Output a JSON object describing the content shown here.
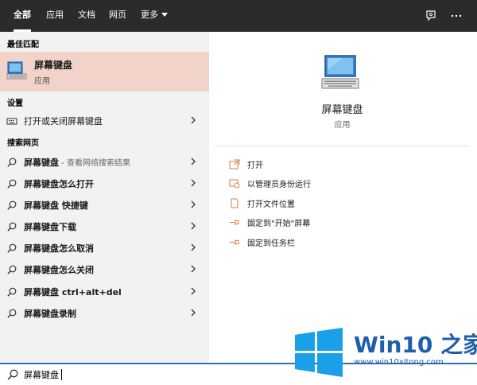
{
  "nav": {
    "tabs": [
      {
        "label": "全部",
        "active": true
      },
      {
        "label": "应用"
      },
      {
        "label": "文档"
      },
      {
        "label": "网页"
      },
      {
        "label": "更多"
      }
    ],
    "feedback_icon": "feedback-icon",
    "more_icon": "ellipsis-icon"
  },
  "best_match": {
    "header": "最佳匹配",
    "title": "屏幕键盘",
    "subtitle": "应用",
    "icon": "computer-icon"
  },
  "settings": {
    "header": "设置",
    "items": [
      {
        "label": "打开或关闭屏幕键盘",
        "icon": "keyboard-icon"
      }
    ]
  },
  "web": {
    "header": "搜索网页",
    "first": {
      "label": "屏幕键盘",
      "hint": " - 查看网络搜索结果"
    },
    "items": [
      {
        "label": "屏幕键盘怎么打开"
      },
      {
        "label": "屏幕键盘 快捷键"
      },
      {
        "label": "屏幕键盘下载"
      },
      {
        "label": "屏幕键盘怎么取消"
      },
      {
        "label": "屏幕键盘怎么关闭"
      },
      {
        "label": "屏幕键盘 ctrl+alt+del"
      },
      {
        "label": "屏幕键盘录制"
      }
    ]
  },
  "detail": {
    "name": "屏幕键盘",
    "type": "应用",
    "actions": [
      {
        "label": "打开",
        "icon": "open-icon"
      },
      {
        "label": "以管理员身份运行",
        "icon": "shield-icon"
      },
      {
        "label": "打开文件位置",
        "icon": "file-icon"
      },
      {
        "label": "固定到\"开始\"屏幕",
        "icon": "pin-icon"
      },
      {
        "label": "固定到任务栏",
        "icon": "pin-icon"
      }
    ]
  },
  "search": {
    "value": "屏幕键盘"
  },
  "watermark": {
    "title": "Win10 之家",
    "url": "www.win10xitong.com"
  },
  "colors": {
    "topbar": "#2b2b2b",
    "best_match_bg": "#f1d3c9",
    "left_bg": "#f2f2f2",
    "search_border": "#2d6fb8",
    "watermark": "#1d5fae"
  }
}
